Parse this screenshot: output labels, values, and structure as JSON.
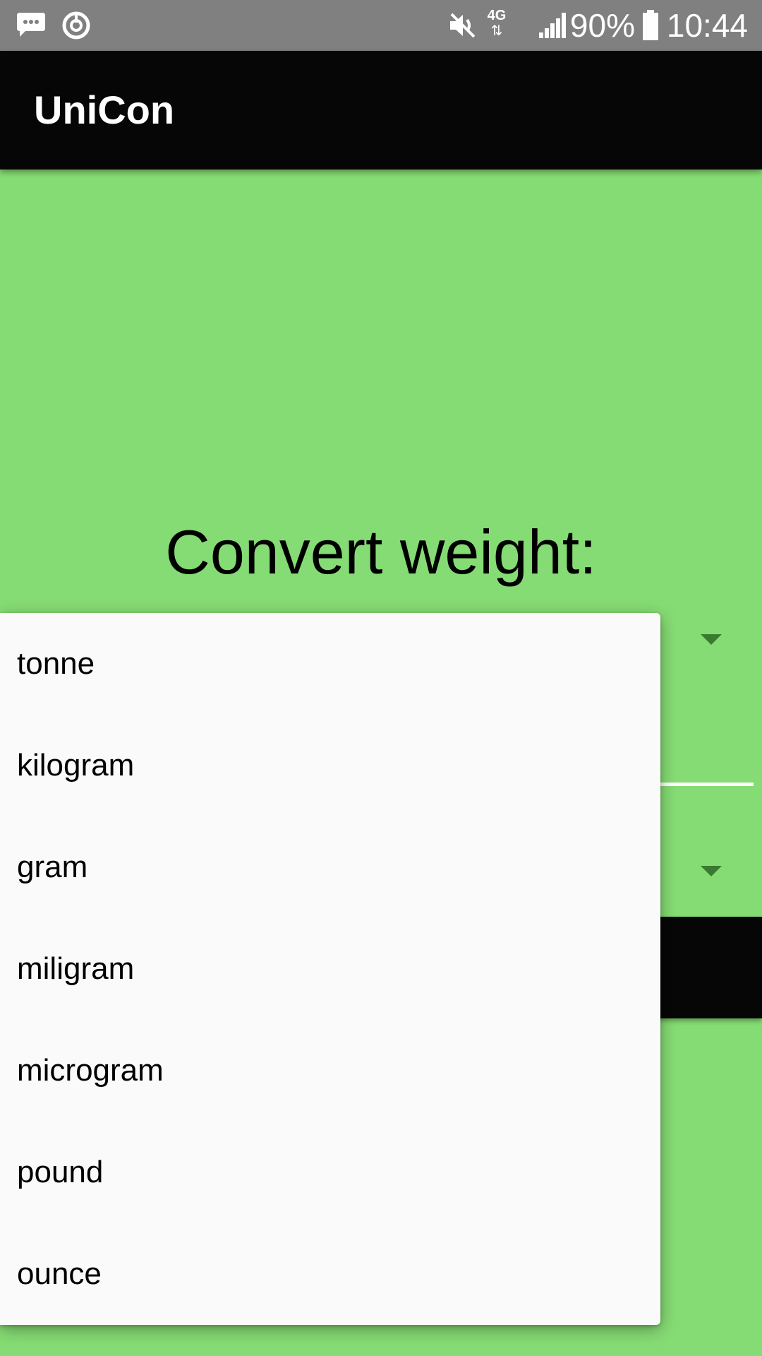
{
  "status_bar": {
    "battery_percent": "90%",
    "time": "10:44",
    "network_type": "4G",
    "icons": [
      "messenger-icon",
      "sync-icon",
      "mute-icon",
      "signal-icon",
      "battery-icon"
    ]
  },
  "app_bar": {
    "title": "UniCon"
  },
  "main": {
    "heading": "Convert weight:"
  },
  "dropdown": {
    "options": [
      "tonne",
      "kilogram",
      "gram",
      "miligram",
      "microgram",
      "pound",
      "ounce"
    ]
  },
  "colors": {
    "background": "#86dc74",
    "app_bar": "#060606",
    "status_bar": "#808080",
    "dropdown": "#fafafa"
  }
}
